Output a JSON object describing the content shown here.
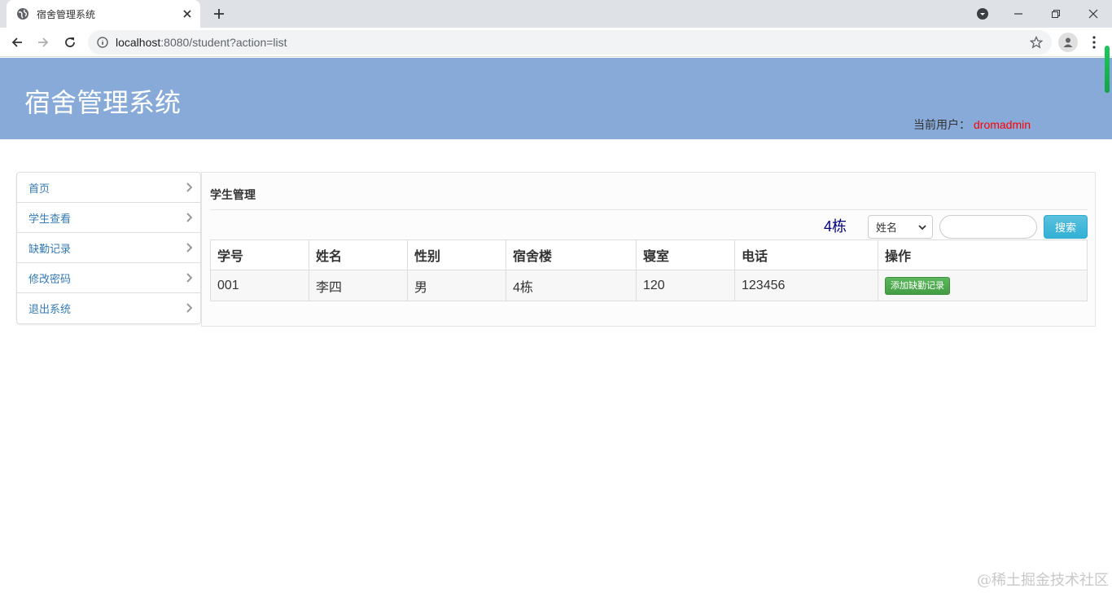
{
  "browser": {
    "tab_title": "宿舍管理系统",
    "url_host": "localhost",
    "url_rest": ":8080/student?action=list"
  },
  "header": {
    "title": "宿舍管理系统",
    "user_label": "当前用户：",
    "user_name": "dromadmin",
    "user_name_color": "#ff0000",
    "background": "#87aad8"
  },
  "sidebar": {
    "items": [
      {
        "label": "首页"
      },
      {
        "label": "学生查看"
      },
      {
        "label": "缺勤记录"
      },
      {
        "label": "修改密码"
      },
      {
        "label": "退出系统"
      }
    ]
  },
  "panel": {
    "title": "学生管理",
    "building": "4栋",
    "search_field_selected": "姓名",
    "search_value": "",
    "search_button": "搜索"
  },
  "table": {
    "headers": [
      "学号",
      "姓名",
      "性别",
      "宿舍楼",
      "寝室",
      "电话",
      "操作"
    ],
    "rows": [
      {
        "id": "001",
        "name": "李四",
        "gender": "男",
        "building": "4栋",
        "room": "120",
        "phone": "123456",
        "action": "添加缺勤记录"
      }
    ]
  },
  "watermark": "@稀土掘金技术社区",
  "icons": {
    "favicon": "globe-icon",
    "tab_close": "close-icon",
    "new_tab": "plus-icon",
    "back": "arrow-left-icon",
    "forward": "arrow-right-icon",
    "reload": "reload-icon",
    "site_info": "info-icon",
    "bookmark": "star-icon",
    "profile": "person-icon",
    "menu": "more-vert-icon"
  }
}
